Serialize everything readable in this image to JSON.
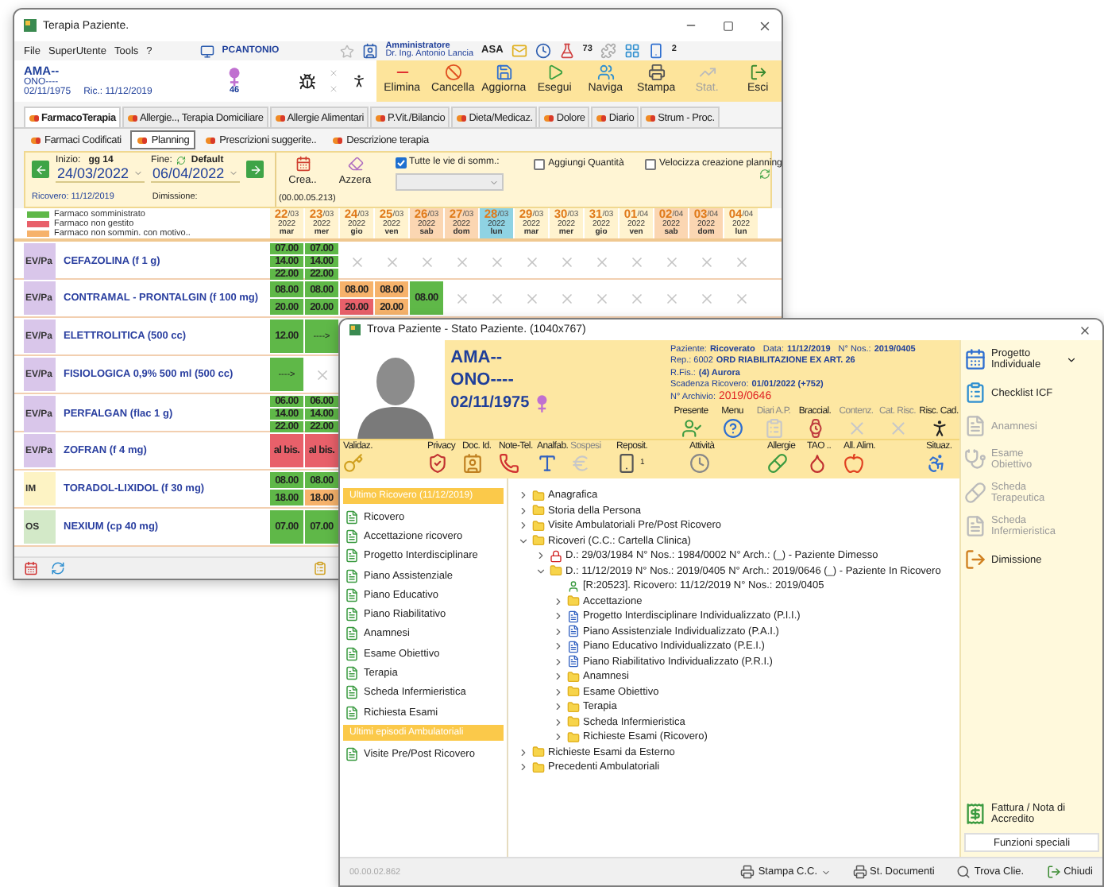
{
  "therapy_window": {
    "title": "Terapia Paziente.",
    "menu": [
      "File",
      "SuperUtente",
      "Tools",
      "?"
    ],
    "station": "PCANTONIO",
    "user_role": "Amministratore",
    "user_name": "Dr. Ing. Antonio Lancia",
    "user_code": "ASA",
    "counters": [
      "73",
      "2"
    ],
    "patient": {
      "surname": "AMA--",
      "name": "ONO----",
      "birth": "02/11/1975",
      "admission": "Ric.: 11/12/2019",
      "age": "46"
    },
    "toolbar": [
      {
        "label": "Elimina",
        "disabled": false
      },
      {
        "label": "Cancella",
        "disabled": false
      },
      {
        "label": "Aggiorna",
        "disabled": false
      },
      {
        "label": "Esegui",
        "disabled": false
      },
      {
        "label": "Naviga",
        "disabled": false
      },
      {
        "label": "Stampa",
        "disabled": false
      },
      {
        "label": "Stat.",
        "disabled": true
      },
      {
        "label": "Esci",
        "disabled": false
      }
    ],
    "tabs": [
      {
        "label": "FarmacoTerapia",
        "selected": true
      },
      {
        "label": "Allergie.., Terapia Domiciliare",
        "selected": false
      },
      {
        "label": "Allergie Alimentari",
        "selected": false
      },
      {
        "label": "P.Vit./Bilancio",
        "selected": false
      },
      {
        "label": "Dieta/Medicaz.",
        "selected": false
      },
      {
        "label": "Dolore",
        "selected": false
      },
      {
        "label": "Diario",
        "selected": false
      },
      {
        "label": "Strum - Proc.",
        "selected": false
      }
    ],
    "subtabs": [
      {
        "label": "Farmaci Codificati",
        "selected": false
      },
      {
        "label": "Planning",
        "selected": true
      },
      {
        "label": "Prescrizioni suggerite..",
        "selected": false
      },
      {
        "label": "Descrizione terapia",
        "selected": false
      }
    ],
    "planning": {
      "start_label": "Inizio:",
      "days": "gg 14",
      "start_date": "24/03/2022",
      "end_label": "Fine:",
      "default_label": "Default",
      "end_date": "06/04/2022",
      "admission": "Ricovero: 11/12/2019",
      "discharge": "Dimissione:",
      "create": "Crea..",
      "reset": "Azzera",
      "timer": "(00.00.05.213)",
      "all_routes": {
        "label": "Tutte le vie di somm.:",
        "checked": true
      },
      "add_quantity": {
        "label": "Aggiungi Quantità",
        "checked": false
      },
      "speed_up": {
        "label": "Velocizza creazione planning",
        "checked": false
      }
    },
    "legend": [
      {
        "label": "Farmaco somministrato",
        "color": "#5fb848"
      },
      {
        "label": "Farmaco non gestito",
        "color": "#e8606a"
      },
      {
        "label": "Farmaco non sommin. con motivo..",
        "color": "#f6b26b"
      }
    ],
    "dates": [
      {
        "day": "22",
        "month": "/03",
        "year": "2022",
        "weekday": "mar",
        "kind": "workday"
      },
      {
        "day": "23",
        "month": "/03",
        "year": "2022",
        "weekday": "mer",
        "kind": "workday"
      },
      {
        "day": "24",
        "month": "/03",
        "year": "2022",
        "weekday": "gio",
        "kind": "workday"
      },
      {
        "day": "25",
        "month": "/03",
        "year": "2022",
        "weekday": "ven",
        "kind": "workday"
      },
      {
        "day": "26",
        "month": "/03",
        "year": "2022",
        "weekday": "sab",
        "kind": "weekend"
      },
      {
        "day": "27",
        "month": "/03",
        "year": "2022",
        "weekday": "dom",
        "kind": "weekend"
      },
      {
        "day": "28",
        "month": "/03",
        "year": "2022",
        "weekday": "lun",
        "kind": "today"
      },
      {
        "day": "29",
        "month": "/03",
        "year": "2022",
        "weekday": "mar",
        "kind": "workday"
      },
      {
        "day": "30",
        "month": "/03",
        "year": "2022",
        "weekday": "mer",
        "kind": "workday"
      },
      {
        "day": "31",
        "month": "/03",
        "year": "2022",
        "weekday": "gio",
        "kind": "workday"
      },
      {
        "day": "01",
        "month": "/04",
        "year": "2022",
        "weekday": "ven",
        "kind": "workday"
      },
      {
        "day": "02",
        "month": "/04",
        "year": "2022",
        "weekday": "sab",
        "kind": "weekend"
      },
      {
        "day": "03",
        "month": "/04",
        "year": "2022",
        "weekday": "dom",
        "kind": "weekend"
      },
      {
        "day": "04",
        "month": "/04",
        "year": "2022",
        "weekday": "lun",
        "kind": "workday"
      }
    ],
    "rows": [
      {
        "route": "EV/Pa",
        "color": "#d9c6ea",
        "drug": "CEFAZOLINA (f 1 g)",
        "cells": [
          {
            "kind": "times",
            "times": [
              {
                "text": "07.00",
                "kind": "given"
              },
              {
                "text": "14.00",
                "kind": "given"
              },
              {
                "text": "22.00",
                "kind": "given"
              }
            ]
          },
          {
            "kind": "times",
            "times": [
              {
                "text": "07.00",
                "kind": "given"
              },
              {
                "text": "14.00",
                "kind": "given"
              },
              {
                "text": "22.00",
                "kind": "given"
              }
            ]
          },
          {
            "kind": "none"
          },
          {
            "kind": "none"
          },
          {
            "kind": "none"
          },
          {
            "kind": "none"
          },
          {
            "kind": "none"
          },
          {
            "kind": "none"
          },
          {
            "kind": "none"
          },
          {
            "kind": "none"
          },
          {
            "kind": "none"
          },
          {
            "kind": "none"
          },
          {
            "kind": "none"
          },
          {
            "kind": "none"
          }
        ]
      },
      {
        "route": "EV/Pa",
        "color": "#d9c6ea",
        "drug": "CONTRAMAL - PRONTALGIN (f 100 mg)",
        "cells": [
          {
            "kind": "times",
            "times": [
              {
                "text": "08.00",
                "kind": "given"
              },
              {
                "text": "20.00",
                "kind": "given"
              }
            ]
          },
          {
            "kind": "times",
            "times": [
              {
                "text": "08.00",
                "kind": "given"
              },
              {
                "text": "20.00",
                "kind": "given"
              }
            ]
          },
          {
            "kind": "times",
            "times": [
              {
                "text": "08.00",
                "kind": "reason"
              },
              {
                "text": "20.00",
                "kind": "missed"
              }
            ]
          },
          {
            "kind": "times",
            "times": [
              {
                "text": "08.00",
                "kind": "reason"
              },
              {
                "text": "20.00",
                "kind": "reason"
              }
            ]
          },
          {
            "kind": "times",
            "times": [
              {
                "text": "08.00",
                "kind": "given"
              }
            ]
          },
          {
            "kind": "none"
          },
          {
            "kind": "none"
          },
          {
            "kind": "none"
          },
          {
            "kind": "none"
          },
          {
            "kind": "none"
          },
          {
            "kind": "none"
          },
          {
            "kind": "none"
          },
          {
            "kind": "none"
          },
          {
            "kind": "none"
          }
        ]
      },
      {
        "route": "EV/Pa",
        "color": "#d9c6ea",
        "drug": "ELETTROLITICA (500 cc)",
        "cells": [
          {
            "kind": "times",
            "times": [
              {
                "text": "12.00",
                "kind": "given"
              }
            ]
          },
          {
            "kind": "arrow",
            "text": "---->"
          }
        ]
      },
      {
        "route": "EV/Pa",
        "color": "#d9c6ea",
        "drug": "FISIOLOGICA 0,9%  500 ml (500 cc)",
        "cells": [
          {
            "kind": "arrow",
            "text": "---->"
          },
          {
            "kind": "none"
          }
        ]
      },
      {
        "route": "EV/Pa",
        "color": "#d9c6ea",
        "drug": "PERFALGAN (flac 1 g)",
        "cells": [
          {
            "kind": "times",
            "times": [
              {
                "text": "06.00",
                "kind": "given"
              },
              {
                "text": "14.00",
                "kind": "given"
              },
              {
                "text": "22.00",
                "kind": "given"
              }
            ]
          },
          {
            "kind": "times",
            "times": [
              {
                "text": "06.00",
                "kind": "given"
              },
              {
                "text": "14.00",
                "kind": "given"
              },
              {
                "text": "22.00",
                "kind": "given"
              }
            ]
          }
        ]
      },
      {
        "route": "EV/Pa",
        "color": "#d9c6ea",
        "drug": "ZOFRAN (f 4 mg)",
        "cells": [
          {
            "kind": "times",
            "times": [
              {
                "text": "al bis.",
                "kind": "missed"
              }
            ]
          },
          {
            "kind": "times",
            "times": [
              {
                "text": "al bis.",
                "kind": "missed"
              }
            ]
          }
        ]
      },
      {
        "route": "IM",
        "color": "#fdf3c4",
        "drug": "TORADOL-LIXIDOL (f 30 mg)",
        "cells": [
          {
            "kind": "times",
            "times": [
              {
                "text": "08.00",
                "kind": "given"
              },
              {
                "text": "18.00",
                "kind": "given"
              }
            ]
          },
          {
            "kind": "times",
            "times": [
              {
                "text": "08.00",
                "kind": "given"
              },
              {
                "text": "18.00",
                "kind": "reason"
              }
            ]
          }
        ]
      },
      {
        "route": "OS",
        "color": "#d3e9c8",
        "drug": "NEXIUM (cp 40 mg)",
        "cells": [
          {
            "kind": "times",
            "times": [
              {
                "text": "07.00",
                "kind": "given"
              }
            ]
          },
          {
            "kind": "times",
            "times": [
              {
                "text": "07.00",
                "kind": "given"
              }
            ]
          }
        ]
      }
    ]
  },
  "status_window": {
    "title": "Trova Paziente - Stato Paziente. (1040x767)",
    "patient": {
      "surname": "AMA--",
      "name": "ONO----",
      "birth": "02/11/1975"
    },
    "info": [
      [
        {
          "label": "Paziente:",
          "value": "Ricoverato",
          "kind": "normal"
        },
        {
          "label": "Data:",
          "value": "11/12/2019",
          "kind": "normal"
        },
        {
          "label": "N° Nos.:",
          "value": "2019/0405",
          "kind": "normal"
        }
      ],
      [
        {
          "label": "Rep.: 6002",
          "value": "ORD  RIABILITAZIONE EX ART. 26",
          "kind": "normal"
        }
      ],
      [
        {
          "label": "R.Fis.:",
          "value": "(4) Aurora",
          "kind": "normal"
        }
      ],
      [
        {
          "label": "Scadenza Ricovero:",
          "value": "01/01/2022 (+752)",
          "kind": "normal"
        }
      ],
      [
        {
          "label": "N° Archivio:",
          "value": "2019/0646",
          "kind": "alert"
        }
      ]
    ],
    "status_icons": [
      {
        "label": "Presente",
        "disabled": false
      },
      {
        "label": "Menu",
        "disabled": false
      },
      {
        "label": "Diari A.P.",
        "disabled": true
      },
      {
        "label": "Braccial.",
        "disabled": false
      },
      {
        "label": "Contenz.",
        "disabled": true
      },
      {
        "label": "Cat. Risc.",
        "disabled": true
      },
      {
        "label": "Risc. Cad.",
        "disabled": false
      }
    ],
    "quick_icons": [
      {
        "label": "Validaz.",
        "disabled": false
      },
      {
        "label": "Privacy",
        "disabled": false
      },
      {
        "label": "Doc. Id.",
        "disabled": false
      },
      {
        "label": "Note-Tel.",
        "disabled": false
      },
      {
        "label": "Analfab.",
        "disabled": false
      },
      {
        "label": "Sospesi",
        "disabled": true
      },
      {
        "label": "Reposit.",
        "disabled": false,
        "count": "1"
      },
      {
        "label": "Attività",
        "disabled": false
      },
      {
        "label": "Allergie",
        "disabled": false
      },
      {
        "label": "TAO ..",
        "disabled": false
      },
      {
        "label": "All. Alim.",
        "disabled": false
      },
      {
        "label": "Situaz.",
        "disabled": false
      }
    ],
    "sections": [
      {
        "title": "Ultimo Ricovero (11/12/2019)",
        "items": [
          "Ricovero",
          "Accettazione ricovero",
          "Progetto Interdisciplinare",
          "Piano Assistenziale",
          "Piano Educativo",
          "Piano Riabilitativo",
          "Anamnesi",
          "Esame Obiettivo",
          "Terapia",
          "Scheda Infermieristica",
          "Richiesta Esami"
        ]
      },
      {
        "title": "Ultimi episodi Ambulatoriali",
        "items": [
          "Visite Pre/Post Ricovero"
        ]
      }
    ],
    "tree": [
      {
        "label": "Anagrafica",
        "kind": "folder",
        "expanded": false
      },
      {
        "label": "Storia della Persona",
        "kind": "folder",
        "expanded": false
      },
      {
        "label": "Visite Ambulatoriali Pre/Post Ricovero",
        "kind": "folder",
        "expanded": false
      },
      {
        "label": "Ricoveri (C.C.: Cartella Clinica)",
        "kind": "folder",
        "expanded": true,
        "children": [
          {
            "label": "D.: 29/03/1984 N° Nos.: 1984/0002 N° Arch.:   (_) - Paziente Dimesso",
            "kind": "locked",
            "expanded": false
          },
          {
            "label": "D.: 11/12/2019 N° Nos.: 2019/0405 N° Arch.:  2019/0646 (_) - Paziente In Ricovero",
            "kind": "folder",
            "expanded": true,
            "children": [
              {
                "label": "[R:20523]. Ricovero: 11/12/2019 N° Nos.: 2019/0405",
                "kind": "record"
              },
              {
                "label": "Accettazione",
                "kind": "folder",
                "expanded": false
              },
              {
                "label": "Progetto Interdisciplinare Individualizzato (P.I.I.)",
                "kind": "plan",
                "expanded": false
              },
              {
                "label": "Piano Assistenziale Individualizzato (P.A.I.)",
                "kind": "plan",
                "expanded": false
              },
              {
                "label": "Piano Educativo Individualizzato (P.E.I.)",
                "kind": "plan",
                "expanded": false
              },
              {
                "label": "Piano Riabilitativo Individualizzato (P.R.I.)",
                "kind": "plan",
                "expanded": false
              },
              {
                "label": "Anamnesi",
                "kind": "folder",
                "expanded": false
              },
              {
                "label": "Esame Obiettivo",
                "kind": "folder",
                "expanded": false
              },
              {
                "label": "Terapia",
                "kind": "folder",
                "expanded": false
              },
              {
                "label": "Scheda Infermieristica",
                "kind": "folder",
                "expanded": false
              },
              {
                "label": "Richieste Esami (Ricovero)",
                "kind": "folder",
                "expanded": false
              }
            ]
          }
        ]
      },
      {
        "label": "Richieste Esami da Esterno",
        "kind": "folder",
        "expanded": false
      },
      {
        "label": "Precedenti Ambulatoriali",
        "kind": "folder",
        "expanded": false
      }
    ],
    "actions": [
      {
        "label": "Progetto Individuale",
        "disabled": false,
        "dropdown": true
      },
      {
        "label": "Checklist ICF",
        "disabled": false,
        "dropdown": false
      },
      {
        "label": "Anamnesi",
        "disabled": true,
        "dropdown": false
      },
      {
        "label": "Esame Obiettivo",
        "disabled": true,
        "dropdown": false
      },
      {
        "label": "Scheda Terapeutica",
        "disabled": true,
        "dropdown": false
      },
      {
        "label": "Scheda Infermieristica",
        "disabled": true,
        "dropdown": false
      },
      {
        "label": "Dimissione",
        "disabled": false,
        "dropdown": false
      }
    ],
    "invoice": "Fattura / Nota di Accredito",
    "special_button": "Funzioni speciali",
    "elapsed": "00.00.02.862",
    "bottom_buttons": [
      {
        "label": "Stampa C.C.",
        "dropdown": true
      },
      {
        "label": "St. Documenti",
        "dropdown": false
      },
      {
        "label": "Trova Clie.",
        "dropdown": false
      },
      {
        "label": "Chiudi",
        "dropdown": false
      }
    ]
  }
}
